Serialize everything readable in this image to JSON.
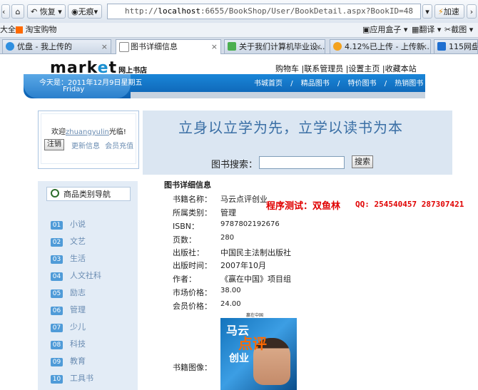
{
  "browser": {
    "back_label": "恢复",
    "traceless_label": "无痕",
    "url_prefix": "http://",
    "url_host": "localhost",
    "url_rest": ":6655/BookShop/User/BookDetail.aspx?BookID=48",
    "accelerate_label": "加速",
    "fav_left": "大全",
    "fav_taobao": "淘宝购物",
    "fav_appbox": "应用盒子",
    "fav_translate": "翻译",
    "fav_screenshot": "截图",
    "tabs": [
      {
        "label": "优盘 - 我上传的"
      },
      {
        "label": "图书详细信息"
      },
      {
        "label": "关于我们计算机毕业设..."
      },
      {
        "label": "4.12%已上传 - 上传新..."
      },
      {
        "label": "115网盘"
      }
    ]
  },
  "header": {
    "logo_pre": "mark",
    "logo_o": "e",
    "logo_post": "t",
    "logo_sub": "网上书店",
    "top_links": "购物车 |联系管理员 |设置主页 |收藏本站",
    "date_line1": "今天是：2011年12月9日星期五",
    "date_line2": "Friday",
    "nav": [
      "书城首页",
      "精品图书",
      "特价图书",
      "热销图书"
    ]
  },
  "user": {
    "welcome_pre": "欢迎",
    "username": "zhuangyulin",
    "welcome_post": "光临!",
    "logout": "注销",
    "update_info": "更新信息",
    "recharge": "会员充值"
  },
  "banner": {
    "slogan": "立身以立学为先，立学以读书为本",
    "search_label": "图书搜索：",
    "search_value": "",
    "search_button": "搜索"
  },
  "sidebar": {
    "title": "商品类别导航",
    "items": [
      {
        "num": "01",
        "label": "小说"
      },
      {
        "num": "02",
        "label": "文艺"
      },
      {
        "num": "03",
        "label": "生活"
      },
      {
        "num": "04",
        "label": "人文社科"
      },
      {
        "num": "05",
        "label": "励志"
      },
      {
        "num": "06",
        "label": "管理"
      },
      {
        "num": "07",
        "label": "少儿"
      },
      {
        "num": "08",
        "label": "科技"
      },
      {
        "num": "09",
        "label": "教育"
      },
      {
        "num": "10",
        "label": "工具书"
      }
    ]
  },
  "detail": {
    "title": "图书详细信息",
    "rows": [
      {
        "label": "书籍名称：",
        "value": "马云点评创业"
      },
      {
        "label": "所属类别：",
        "value": "管理"
      },
      {
        "label": "ISBN：",
        "value": "9787802192676"
      },
      {
        "label": "页数：",
        "value": "280"
      },
      {
        "label": "出版社：",
        "value": "中国民主法制出版社"
      },
      {
        "label": "出版时间：",
        "value": "2007年10月"
      },
      {
        "label": "作者：",
        "value": "《赢在中国》项目组"
      },
      {
        "label": "市场价格：",
        "value": "38.00"
      },
      {
        "label": "会员价格：",
        "value": "24.00"
      }
    ],
    "image_label": "书籍图像：",
    "tester": "程序测试：双鱼林",
    "qq": "QQ: 254540457 287307421",
    "cover": {
      "line1": "马云",
      "line2": "点评",
      "line3": "创业",
      "series": "赢在中国"
    }
  }
}
